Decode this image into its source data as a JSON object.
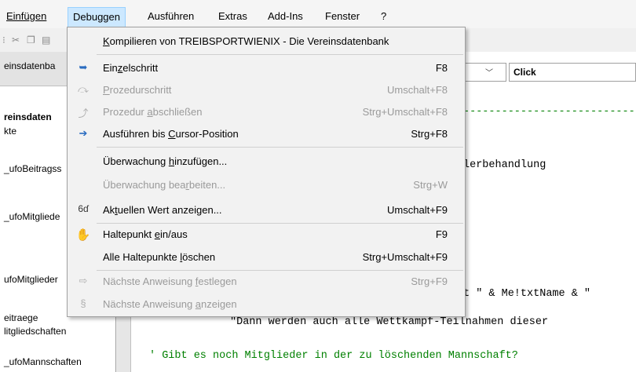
{
  "menubar": {
    "items": [
      "Einfügen",
      "Debuggen",
      "Ausführen",
      "Extras",
      "Add-Ins",
      "Fenster",
      "?"
    ]
  },
  "project": {
    "title_partial": "einsdatenba",
    "tree": [
      "reinsdaten",
      "kte",
      "_ufoBeitragss",
      "_ufoMitgliede",
      "ufoMitglieder",
      "eitraege",
      "litgliedschaften",
      "_ufoMannschaften"
    ]
  },
  "code": {
    "proc_combo": "Click",
    "lines": {
      "dashes": "----------------------------",
      "err": "lerbehandlung",
      "msg": "t \" & Me!txtName & \"",
      "dann": "\"Dann werden auch alle Wettkampf-Teilnahmen dieser",
      "comment": "' Gibt es noch Mitglieder in der zu löschenden Mannschaft?"
    }
  },
  "menu": {
    "compile": {
      "pre": "",
      "u": "K",
      "post": "ompilieren von TREIBSPORTWIENIX - Die Vereinsdatenbank"
    },
    "items": [
      {
        "pre": "Ein",
        "u": "z",
        "post": "elschritt",
        "shortcut": "F8",
        "icon": "step-into-icon",
        "disabled": false
      },
      {
        "pre": "",
        "u": "P",
        "post": "rozedurschritt",
        "shortcut": "Umschalt+F8",
        "icon": "step-over-icon",
        "disabled": true
      },
      {
        "pre": "Prozedur ",
        "u": "a",
        "post": "bschließen",
        "shortcut": "Strg+Umschalt+F8",
        "icon": "step-out-icon",
        "disabled": true
      },
      {
        "pre": "Ausführen bis ",
        "u": "C",
        "post": "ursor-Position",
        "shortcut": "Strg+F8",
        "icon": "run-to-cursor-icon",
        "disabled": false
      },
      {
        "pre": "Überwachung ",
        "u": "h",
        "post": "inzufügen...",
        "shortcut": "",
        "icon": "",
        "disabled": false
      },
      {
        "pre": "Überwachung bea",
        "u": "r",
        "post": "beiten...",
        "shortcut": "Strg+W",
        "icon": "",
        "disabled": true
      },
      {
        "pre": "Ak",
        "u": "t",
        "post": "uellen Wert anzeigen...",
        "shortcut": "Umschalt+F9",
        "icon": "quick-watch-icon",
        "disabled": false
      },
      {
        "pre": "Haltepunkt ",
        "u": "e",
        "post": "in/aus",
        "shortcut": "F9",
        "icon": "breakpoint-hand-icon",
        "disabled": false
      },
      {
        "pre": "Alle Haltepunkte ",
        "u": "l",
        "post": "öschen",
        "shortcut": "Strg+Umschalt+F9",
        "icon": "",
        "disabled": false
      },
      {
        "pre": "Nächste Anweisung ",
        "u": "f",
        "post": "estlegen",
        "shortcut": "Strg+F9",
        "icon": "set-next-icon",
        "disabled": true
      },
      {
        "pre": "Nächste Anweisung ",
        "u": "a",
        "post": "nzeigen",
        "shortcut": "",
        "icon": "show-next-icon",
        "disabled": true
      }
    ]
  }
}
